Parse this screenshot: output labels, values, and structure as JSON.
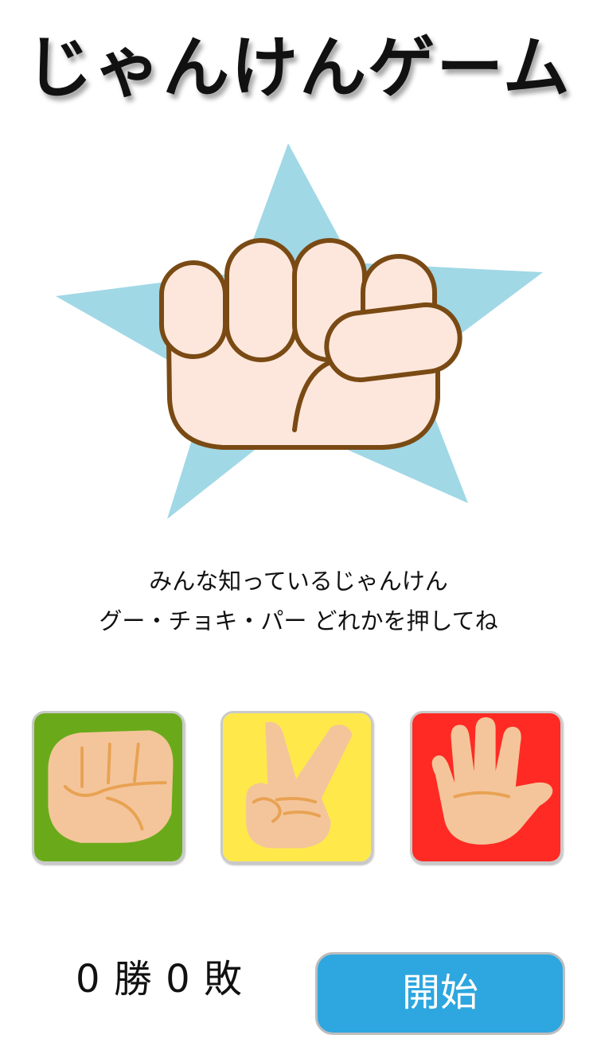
{
  "title": "じゃんけんゲーム",
  "hero": {
    "icon": "fist-on-star-icon",
    "star_color": "#a0d8e6"
  },
  "description": {
    "line1": "みんな知っているじゃんけん",
    "line2": "グー・チョキ・パー どれかを押してね"
  },
  "choices": [
    {
      "name": "rock",
      "icon": "rock-hand-icon",
      "bg": "#6aaa1a"
    },
    {
      "name": "scissors",
      "icon": "scissors-hand-icon",
      "bg": "#ffe94a"
    },
    {
      "name": "paper",
      "icon": "paper-hand-icon",
      "bg": "#ff2a24"
    }
  ],
  "score": {
    "wins": "0",
    "wins_label": "勝",
    "losses": "0",
    "losses_label": "敗"
  },
  "start_button": {
    "label": "開始",
    "color": "#2ea6df"
  }
}
